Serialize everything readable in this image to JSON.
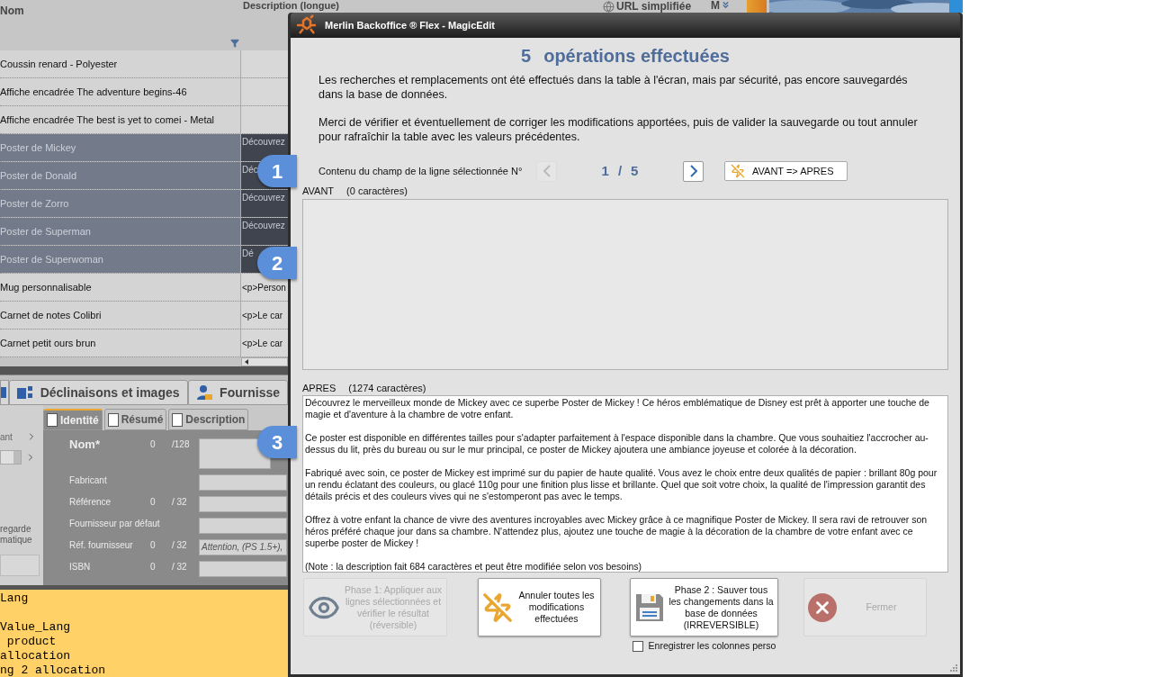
{
  "background_app": {
    "grid": {
      "columns": [
        "Nom",
        "Description (longue)",
        "URL simplifiée",
        "M"
      ],
      "rows": [
        {
          "name": "Coussin renard - Polyester",
          "description": "",
          "selected": false
        },
        {
          "name": "Affiche encadrée The adventure begins-46",
          "description": "",
          "selected": false
        },
        {
          "name": "Affiche encadrée The best is yet to comei - Metal",
          "description": "",
          "selected": false
        },
        {
          "name": "Poster de Mickey",
          "description": "Découvrez",
          "selected": true
        },
        {
          "name": "Poster de Donald",
          "description": "Déc",
          "selected": true
        },
        {
          "name": "Poster de Zorro",
          "description": "Découvrez",
          "selected": true
        },
        {
          "name": "Poster de Superman",
          "description": "Découvrez",
          "selected": true
        },
        {
          "name": "Poster de Superwoman",
          "description": "Dé",
          "selected": true
        },
        {
          "name": "Mug personnalisable",
          "description": "<p>Person",
          "selected": false
        },
        {
          "name": "Carnet de notes Colibri",
          "description": "<p>Le car",
          "selected": false
        },
        {
          "name": "Carnet petit ours brun",
          "description": "<p>Le car",
          "selected": false
        }
      ]
    },
    "tabs": [
      {
        "label": "Déclinaisons et images",
        "selected": false
      },
      {
        "label": "Fournisse",
        "selected": false
      }
    ],
    "side_texts": [
      "ant",
      "regarde",
      "matique"
    ],
    "sub_tabs": [
      {
        "label": "Identité",
        "selected": true
      },
      {
        "label": "Résumé",
        "selected": false
      },
      {
        "label": "Description",
        "selected": false
      }
    ],
    "form": {
      "disabled": true,
      "fields": [
        {
          "label": "Nom*",
          "count": "0",
          "max": "/128"
        },
        {
          "label": "Fabricant"
        },
        {
          "label": "Référence",
          "count": "0",
          "max": "/ 32"
        },
        {
          "label": "Fournisseur par défaut"
        },
        {
          "label": "Réf. fournisseur",
          "count": "0",
          "max": "/ 32",
          "value": "Attention, (PS 1.5+),"
        },
        {
          "label": "ISBN",
          "count": "0",
          "max": "/ 32"
        }
      ]
    },
    "code_text": "Lang\n\nValue_Lang\n product\nallocation\nng 2 allocation"
  },
  "callouts": [
    "1",
    "2",
    "3"
  ],
  "dialog": {
    "title": "Merlin Backoffice ® Flex - MagicEdit",
    "count": "5",
    "heading": "opérations effectuées",
    "paragraphs": [
      "Les recherches et remplacements ont été effectués dans la table à l'écran, mais par sécurité, pas encore sauvegardés dans la base de données.",
      "Merci de vérifier et éventuellement de corriger les modifications apportées, puis de valider la sauvegarde ou tout annuler pour rafraîchir la table avec les valeurs précédentes."
    ],
    "nav": {
      "label": "Contenu du champ de la ligne sélectionnée N°",
      "current": "1",
      "separator": "/",
      "total": "5",
      "prev_disabled": true,
      "next_disabled": false,
      "swap_button": "AVANT => APRES"
    },
    "before": {
      "label": "AVANT",
      "chars": "(0 caractères)"
    },
    "after": {
      "label": "APRES",
      "chars": "(1274 caractères)",
      "value": "Découvrez le merveilleux monde de Mickey avec ce superbe Poster de Mickey ! Ce héros emblématique de Disney est prêt à apporter une touche de magie et d'aventure à la chambre de votre enfant.\n\nCe poster est disponible en différentes tailles pour s'adapter parfaitement à l'espace disponible dans la chambre. Que vous souhaitiez l'accrocher au-dessus du lit, près du bureau ou sur le mur principal, ce poster de Mickey ajoutera une ambiance joyeuse et colorée à la décoration.\n\nFabriqué avec soin, ce poster de Mickey est imprimé sur du papier de haute qualité. Vous avez le choix entre deux qualités de papier : brillant 80g pour un rendu éclatant des couleurs, ou glacé 110g pour une finition plus lisse et brillante. Quel que soit votre choix, la qualité de l'impression garantit des détails précis et des couleurs vives qui ne s'estomperont pas avec le temps.\n\nOffrez à votre enfant la chance de vivre des aventures incroyables avec Mickey grâce à ce magnifique Poster de Mickey. Il sera ravi de retrouver son héros préféré chaque jour dans sa chambre. N'attendez plus, ajoutez une touche de magie à la décoration de la chambre de votre enfant avec ce superbe poster de Mickey !\n\n(Note : la description fait 684 caractères et peut être modifiée selon vos besoins)"
    },
    "buttons": [
      {
        "kind": "preview",
        "label": "Phase 1: Appliquer aux lignes sélectionnées et vérifier le résultat (réversible)",
        "disabled": true
      },
      {
        "kind": "cancel",
        "label": "Annuler toutes les modifications effectuées",
        "disabled": false
      },
      {
        "kind": "save",
        "label": "Phase 2 : Sauver tous les changements dans la base de données (IRREVERSIBLE)",
        "disabled": false
      },
      {
        "kind": "close",
        "label": "Fermer",
        "disabled": true
      }
    ],
    "checkbox": {
      "label": "Enregistrer les colonnes perso",
      "checked": false
    }
  }
}
